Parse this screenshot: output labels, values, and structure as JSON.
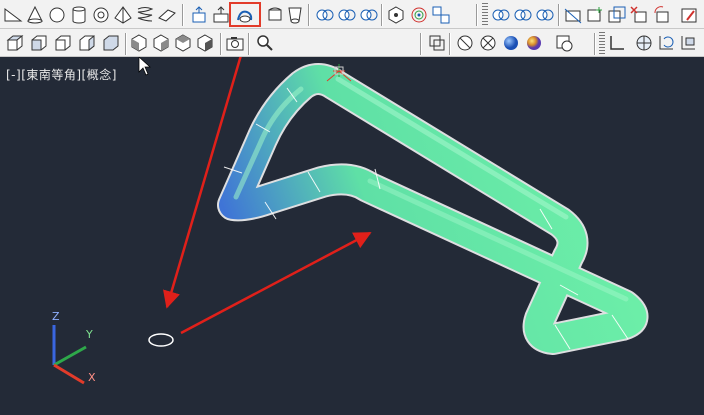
{
  "viewport": {
    "label": "[-][東南等角][概念]",
    "background": "#232a37",
    "visual_style": "概念"
  },
  "layer_combo": {
    "value": ""
  },
  "ucs": {
    "x_label": "X",
    "y_label": "Y",
    "z_label": "Z"
  },
  "highlight": {
    "color": "#e23b2a",
    "target": "sweep-tool-button"
  },
  "toolbar_row1": [
    {
      "name": "wedge-icon"
    },
    {
      "name": "cone-icon"
    },
    {
      "name": "sphere-icon"
    },
    {
      "name": "cylinder-icon"
    },
    {
      "name": "torus-icon"
    },
    {
      "name": "pyramid-icon"
    },
    {
      "name": "helix-icon"
    },
    {
      "name": "planar-surface-icon"
    },
    {
      "name": "extrude-icon"
    },
    {
      "name": "presspull-icon"
    },
    {
      "name": "sweep-icon"
    },
    {
      "name": "revolve-icon"
    },
    {
      "name": "loft-icon"
    },
    {
      "name": "union-icon"
    },
    {
      "name": "subtract-icon"
    },
    {
      "name": "intersect-icon"
    },
    {
      "name": "3d-move-icon"
    },
    {
      "name": "3d-rotate-icon"
    },
    {
      "name": "3d-align-icon"
    },
    {
      "name": "union-icon"
    },
    {
      "name": "subtract-icon"
    },
    {
      "name": "intersect-icon"
    },
    {
      "name": "slice-icon"
    },
    {
      "name": "imprint-icon"
    },
    {
      "name": "copy-edges-icon"
    },
    {
      "name": "delete-faces-icon"
    },
    {
      "name": "rotate-faces-icon"
    },
    {
      "name": "color-faces-icon"
    }
  ],
  "toolbar_row2": [
    {
      "name": "view-top-icon"
    },
    {
      "name": "view-front-icon"
    },
    {
      "name": "view-left-icon"
    },
    {
      "name": "view-right-icon"
    },
    {
      "name": "view-back-icon"
    },
    {
      "name": "sw-iso-icon"
    },
    {
      "name": "se-iso-icon"
    },
    {
      "name": "ne-iso-icon"
    },
    {
      "name": "nw-iso-icon"
    },
    {
      "name": "camera-icon"
    },
    {
      "name": "zoom-icon"
    },
    {
      "name": "2d-wireframe-icon"
    },
    {
      "name": "hidden-icon"
    },
    {
      "name": "wireframe-icon"
    },
    {
      "name": "realistic-icon"
    },
    {
      "name": "conceptual-icon"
    },
    {
      "name": "visual-styles-manager-icon"
    },
    {
      "name": "ucs-icon"
    },
    {
      "name": "ucs-world-icon"
    },
    {
      "name": "ucs-previous-icon"
    },
    {
      "name": "ucs-face-icon"
    }
  ]
}
